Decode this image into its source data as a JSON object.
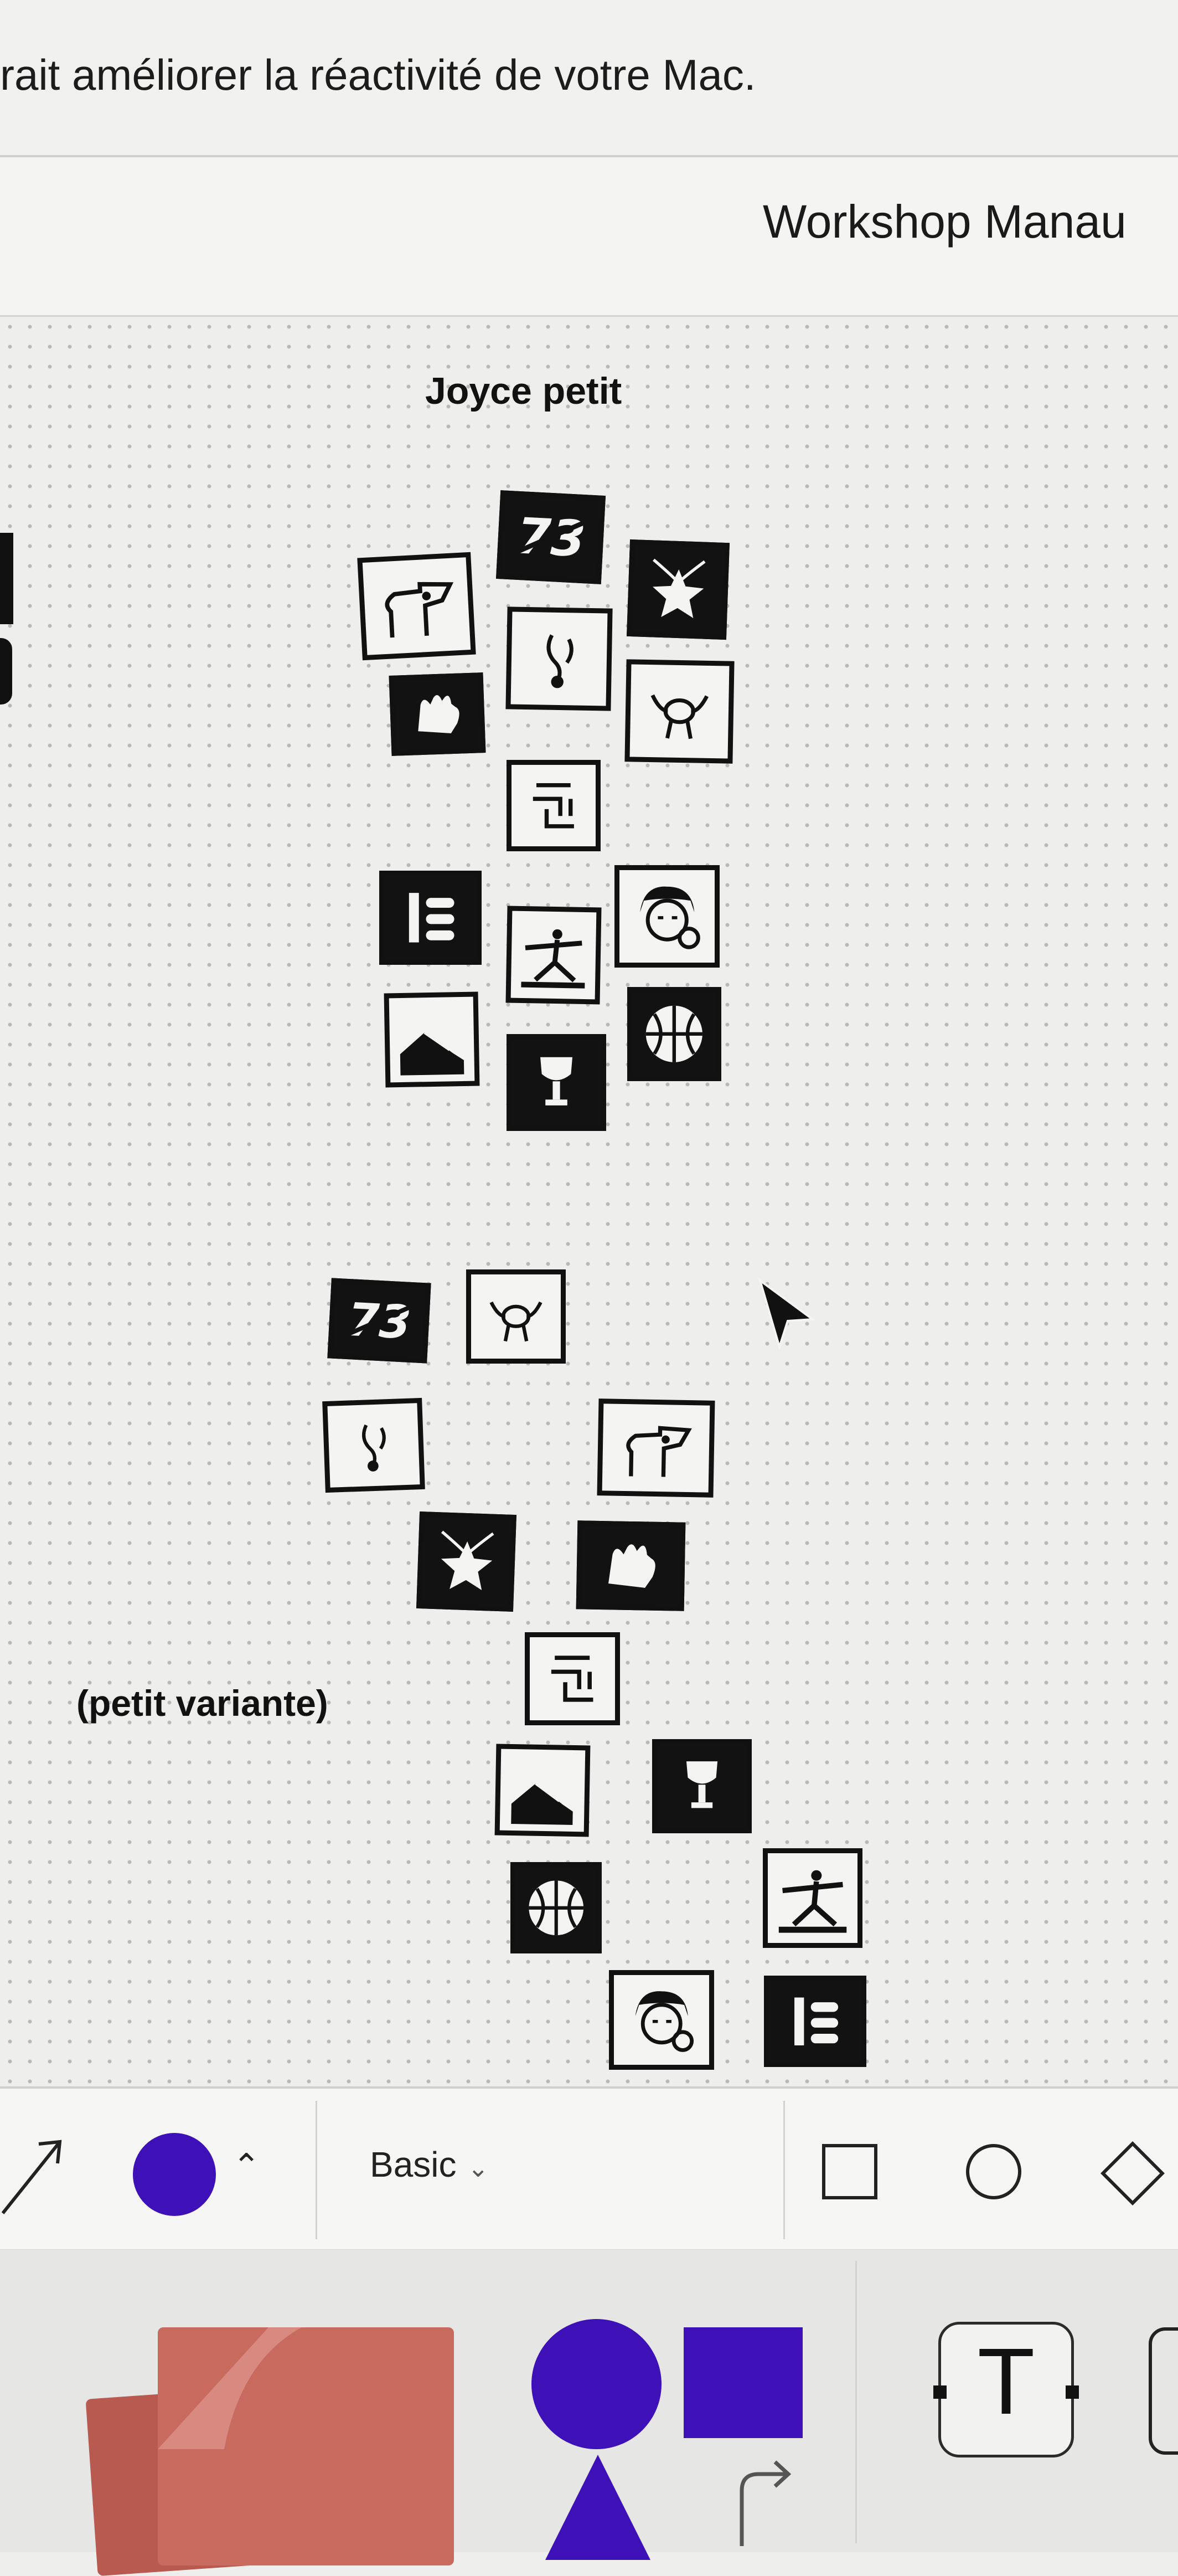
{
  "notification": {
    "text": "rait améliorer la réactivité de votre Mac."
  },
  "document": {
    "title": "Workshop Manau"
  },
  "canvas": {
    "group_label_1": "Joyce petit",
    "group_label_2": "(petit variante)"
  },
  "stickers": [
    {
      "name": "number-73-sticker",
      "theme": "dark"
    },
    {
      "name": "head-profile-sticker",
      "theme": "light"
    },
    {
      "name": "star-brush-sticker",
      "theme": "dark"
    },
    {
      "name": "ballet-feet-sticker",
      "theme": "light"
    },
    {
      "name": "glove-sticker",
      "theme": "dark"
    },
    {
      "name": "hands-ball-sticker",
      "theme": "light"
    },
    {
      "name": "maze-sticker",
      "theme": "light"
    },
    {
      "name": "bars-sticker",
      "theme": "dark"
    },
    {
      "name": "yoga-pose-sticker",
      "theme": "light"
    },
    {
      "name": "girl-face-sticker",
      "theme": "light"
    },
    {
      "name": "leg-sticker",
      "theme": "light"
    },
    {
      "name": "basketball-sticker",
      "theme": "dark"
    },
    {
      "name": "trophy-sticker",
      "theme": "dark"
    }
  ],
  "toolbar": {
    "style_label": "Basic",
    "color": "#3e10b8",
    "tools": [
      "arrow-tool",
      "color-picker",
      "style-dropdown",
      "square-shape",
      "circle-shape",
      "diamond-shape"
    ]
  },
  "panel": {
    "sticky_color": "#c86a5e",
    "shape_color": "#3e10b8",
    "text_tool_glyph": "T"
  }
}
